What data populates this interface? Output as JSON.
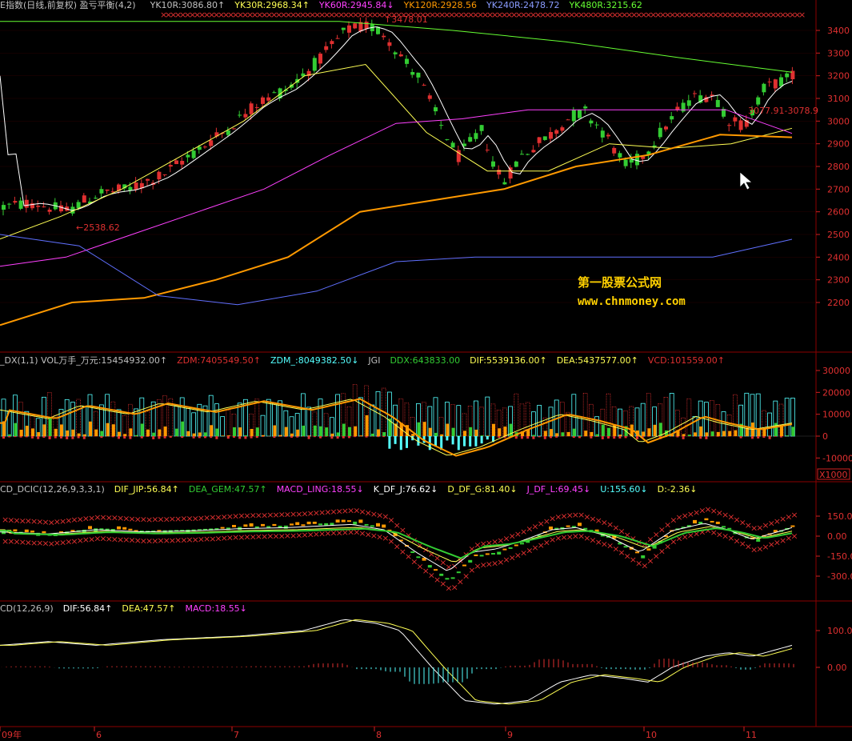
{
  "colors": {
    "up": "#e03030",
    "down": "#33cc33",
    "grid": "#8b0000",
    "axis": "#d02020",
    "cyan": "#54ffff",
    "yellow": "#ffff54",
    "magenta": "#ff40ff",
    "orange": "#ff9900",
    "white": "#ffffff",
    "blue": "#6070ff",
    "green": "#66ff33",
    "pink": "#ff54ff"
  },
  "panels": {
    "main": {
      "labels": [
        {
          "text": "E指数(日线,前复权) 盈亏平衡(4,2)",
          "color": "#c0c0c0"
        },
        {
          "text": "YK10R:3086.80↑",
          "color": "#c0c0c0"
        },
        {
          "text": "YK30R:2968.34↑",
          "color": "#ffff54"
        },
        {
          "text": "YK60R:2945.84↓",
          "color": "#ff40ff"
        },
        {
          "text": "YK120R:2928.56",
          "color": "#ff9900"
        },
        {
          "text": "YK240R:2478.72",
          "color": "#8a9cff"
        },
        {
          "text": "YK480R:3215.62",
          "color": "#66ff33"
        }
      ],
      "annotations": {
        "high": "3478.01",
        "low": "←2538.62",
        "cursor": "3077.91-3078.9"
      },
      "axis_ticks": [
        "3400",
        "3300",
        "3200",
        "3100",
        "3000",
        "2900",
        "2800",
        "2700",
        "2600",
        "2500",
        "2400",
        "2300",
        "2200"
      ]
    },
    "vol": {
      "labels": [
        {
          "text": "_DX(1,1) VOL万手_万元:15454932.00↑",
          "color": "#c0c0c0"
        },
        {
          "text": "ZDM:7405549.50↑",
          "color": "#e03030"
        },
        {
          "text": "ZDM_:8049382.50↓",
          "color": "#54ffff"
        },
        {
          "text": "JGI",
          "color": "#c0c0c0"
        },
        {
          "text": "DDX:643833.00",
          "color": "#33cc33"
        },
        {
          "text": "DIF:5539136.00↑",
          "color": "#ffff54"
        },
        {
          "text": "DEA:5437577.00↑",
          "color": "#ffff54"
        },
        {
          "text": "VCD:101559.00↑",
          "color": "#e03030"
        }
      ],
      "axis_ticks": [
        "30000",
        "20000",
        "10000",
        "0",
        "-10000"
      ],
      "unit": "X1000"
    },
    "dcic": {
      "labels": [
        {
          "text": "CD_DCIC(12,26,9,3,3,1)",
          "color": "#c0c0c0"
        },
        {
          "text": "DIF_JIP:56.84↑",
          "color": "#ffff54"
        },
        {
          "text": "DEA_GEM:47.57↑",
          "color": "#33cc33"
        },
        {
          "text": "MACD_LING:18.55↓",
          "color": "#ff40ff"
        },
        {
          "text": "K_DF_J:76.62↓",
          "color": "#ffffff"
        },
        {
          "text": "D_DF_G:81.40↓",
          "color": "#ffff54"
        },
        {
          "text": "J_DF_L:69.45↓",
          "color": "#ff40ff"
        },
        {
          "text": "U:155.60↓",
          "color": "#54ffff"
        },
        {
          "text": "D:-2.36↓",
          "color": "#ffff54"
        }
      ],
      "axis_ticks": [
        "150.0",
        "0.00",
        "-150.0",
        "-300.0"
      ]
    },
    "macd": {
      "labels": [
        {
          "text": "CD(12,26,9)",
          "color": "#c0c0c0"
        },
        {
          "text": "DIF:56.84↑",
          "color": "#ffffff"
        },
        {
          "text": "DEA:47.57↑",
          "color": "#ffff54"
        },
        {
          "text": "MACD:18.55↓",
          "color": "#ff40ff"
        }
      ],
      "axis_ticks": [
        "100.0",
        "0.00"
      ]
    }
  },
  "time_axis": [
    "09年",
    "6",
    "7",
    "8",
    "9",
    "10",
    "11"
  ],
  "watermark": {
    "line1": "第一股票公式网",
    "line2": "www.chnmoney.com"
  },
  "chart_data": {
    "type": "candlestick",
    "series": [
      {
        "name": "YK10R",
        "values_approx": [
          2640,
          2700,
          2850,
          3050,
          3250,
          3400,
          3150,
          2900,
          2700,
          2850,
          2950,
          2800,
          2900,
          3050,
          3086.8
        ]
      },
      {
        "name": "YK30R",
        "values_approx": [
          2480,
          2580,
          2700,
          2850,
          3000,
          3200,
          3250,
          2950,
          2780,
          2780,
          2900,
          2880,
          2900,
          2968.34
        ]
      },
      {
        "name": "YK60R",
        "values_approx": [
          2360,
          2400,
          2500,
          2600,
          2700,
          2850,
          2990,
          3010,
          3050,
          3050,
          3050,
          3050,
          2945.84
        ]
      },
      {
        "name": "YK120R",
        "values_approx": [
          2100,
          2200,
          2220,
          2300,
          2400,
          2600,
          2650,
          2700,
          2800,
          2850,
          2940,
          2928.56
        ]
      },
      {
        "name": "YK240R",
        "values_approx": [
          2500,
          2450,
          2230,
          2190,
          2250,
          2380,
          2400,
          2400,
          2400,
          2400,
          2478.72
        ]
      },
      {
        "name": "YK480R",
        "values_approx": [
          3440,
          3440,
          3440,
          3440,
          3400,
          3350,
          3280,
          3215.62
        ]
      }
    ],
    "price_high": 3478.01,
    "price_low": 2538.62,
    "ylim": [
      2100,
      3500
    ],
    "x": [
      "09年",
      "6",
      "7",
      "8",
      "9",
      "10",
      "11"
    ]
  }
}
